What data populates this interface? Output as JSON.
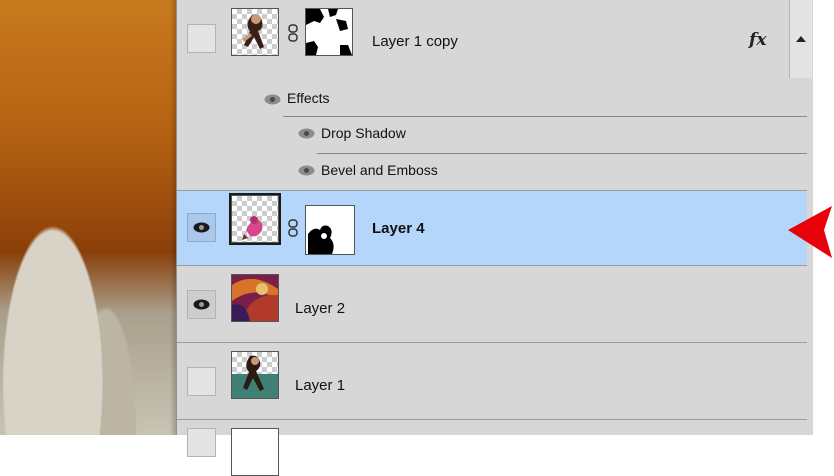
{
  "layers": [
    {
      "name": "Layer 1 copy",
      "visible": false,
      "has_fx": true,
      "fx_label": "fx"
    },
    {
      "name": "Layer 4",
      "visible": true,
      "selected": true
    },
    {
      "name": "Layer 2",
      "visible": true
    },
    {
      "name": "Layer 1",
      "visible": false
    }
  ],
  "effects": {
    "header": "Effects",
    "items": [
      "Drop Shadow",
      "Bevel and Emboss"
    ]
  },
  "colors": {
    "panel_bg": "#d7d7d7",
    "selected_bg": "#b5d6fb",
    "arrow": "#e8000b"
  }
}
